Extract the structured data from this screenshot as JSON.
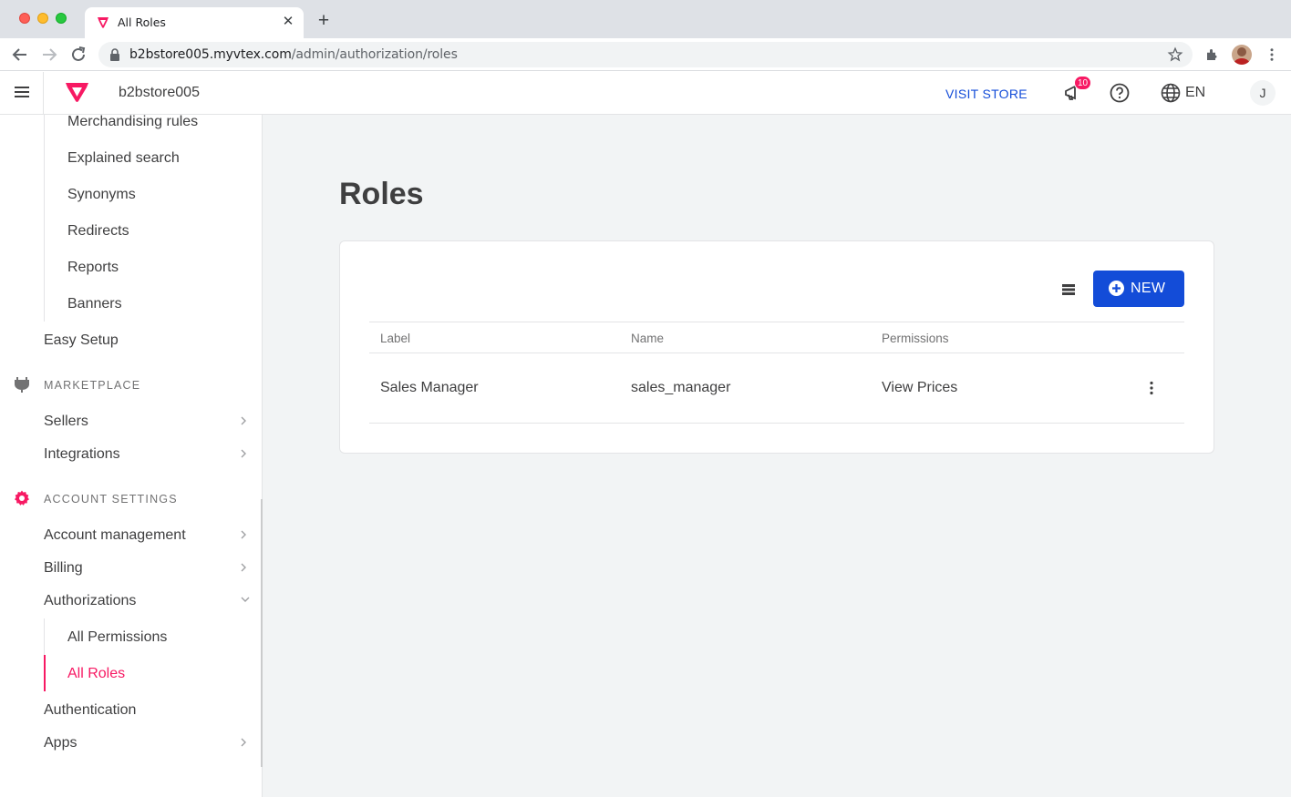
{
  "browser": {
    "tab_title": "All Roles",
    "url_host": "b2bstore005.myvtex.com",
    "url_path": "/admin/authorization/roles"
  },
  "topbar": {
    "store_name": "b2bstore005",
    "visit_store_label": "VISIT STORE",
    "notification_count": "10",
    "language": "EN",
    "avatar_initial": "J"
  },
  "sidebar": {
    "search_subitems": [
      "Merchandising rules",
      "Explained search",
      "Synonyms",
      "Redirects",
      "Reports",
      "Banners"
    ],
    "easy_setup": "Easy Setup",
    "marketplace": {
      "heading": "MARKETPLACE",
      "items": [
        "Sellers",
        "Integrations"
      ]
    },
    "account_settings": {
      "heading": "ACCOUNT SETTINGS",
      "items": [
        "Account management",
        "Billing",
        "Authorizations"
      ],
      "auth_subitems": [
        "All Permissions",
        "All Roles"
      ],
      "more_items": [
        "Authentication",
        "Apps"
      ]
    }
  },
  "main": {
    "page_title": "Roles",
    "new_button_label": "NEW",
    "table": {
      "columns": [
        "Label",
        "Name",
        "Permissions"
      ],
      "rows": [
        {
          "label": "Sales Manager",
          "name": "sales_manager",
          "permissions": "View Prices"
        }
      ]
    }
  },
  "colors": {
    "brand_pink": "#f71963",
    "action_blue": "#134cd8",
    "background": "#f2f4f5"
  }
}
